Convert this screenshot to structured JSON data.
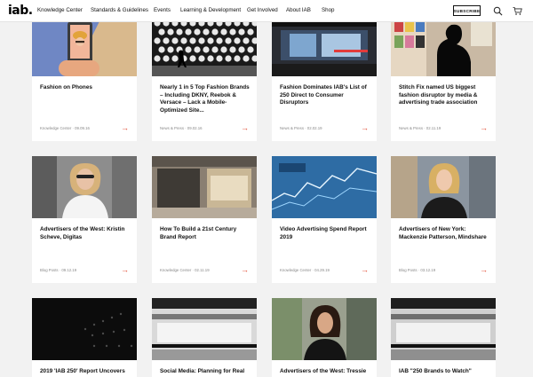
{
  "nav": {
    "logo": "iab.",
    "items": [
      "Knowledge Center",
      "Standards & Guidelines",
      "Events",
      "Learning & Development",
      "Get Involved",
      "About IAB",
      "Shop"
    ],
    "subscribe": "SUBSCRIBE",
    "search_icon": "search-icon",
    "cart_icon": "cart-icon"
  },
  "colors": {
    "accent": "#e0472f",
    "background": "#f2f2f2"
  },
  "cards": [
    {
      "title": "Fashion on Phones",
      "meta": "Knowledge Center · 09.09.16",
      "arrow": "→"
    },
    {
      "title": "Nearly 1 in 5 Top Fashion Brands – Including DKNY, Reebok & Versace – Lack a Mobile-Optimized Site...",
      "meta": "News & Press · 09.02.16",
      "arrow": "→"
    },
    {
      "title": "Fashion Dominates IAB's List of 250 Direct to Consumer Disruptors",
      "meta": "News & Press · 02.02.19",
      "arrow": "→"
    },
    {
      "title": "Stitch Fix named US biggest fashion disruptor by media & advertising trade association",
      "meta": "News & Press · 02.11.19",
      "arrow": "→"
    },
    {
      "title": "Advertisers of the West: Kristin Scheve, Digitas",
      "meta": "Blog Posts · 09.12.19",
      "arrow": "→"
    },
    {
      "title": "How To Build a 21st Century Brand Report",
      "meta": "Knowledge Center · 02.11.19",
      "arrow": "→"
    },
    {
      "title": "Video Advertising Spend Report 2019",
      "meta": "Knowledge Center · 04.29.19",
      "arrow": "→"
    },
    {
      "title": "Advertisers of New York: Mackenzie Patterson, Mindshare",
      "meta": "Blog Posts · 03.12.19",
      "arrow": "→"
    },
    {
      "title": "2019 'IAB 250' Report Uncovers",
      "meta": "",
      "arrow": ""
    },
    {
      "title": "Social Media: Planning for Real",
      "meta": "",
      "arrow": ""
    },
    {
      "title": "Advertisers of the West: Tressie",
      "meta": "",
      "arrow": ""
    },
    {
      "title": "IAB \"250 Brands to Watch\"",
      "meta": "",
      "arrow": ""
    }
  ]
}
